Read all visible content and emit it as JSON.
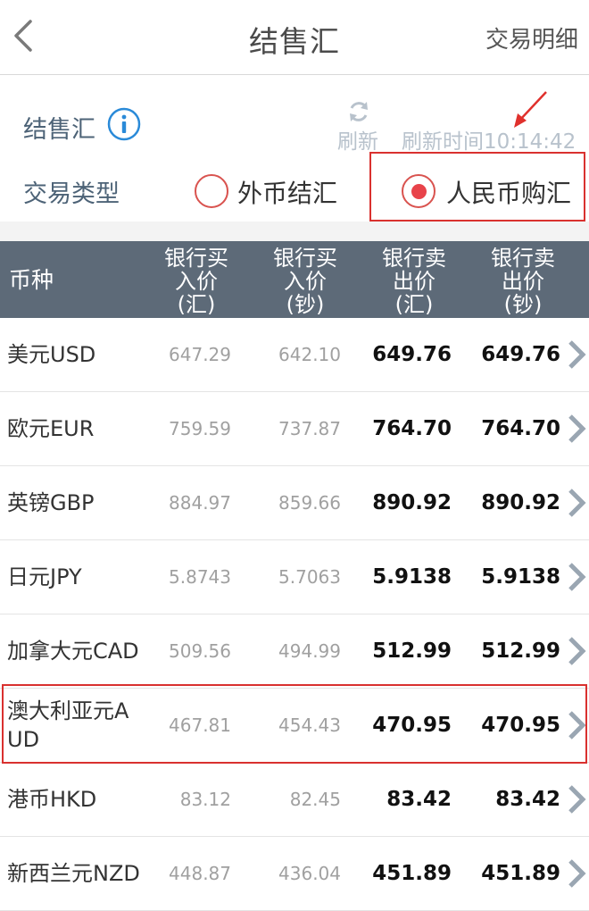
{
  "header": {
    "title": "结售汇",
    "detail_link": "交易明细"
  },
  "controls": {
    "label": "结售汇",
    "refresh_label": "刷新",
    "refresh_time": "刷新时间10:14:42",
    "type_label": "交易类型",
    "options": [
      {
        "label": "外币结汇",
        "selected": false
      },
      {
        "label": "人民币购汇",
        "selected": true
      }
    ]
  },
  "table": {
    "headers": [
      "币种",
      [
        "银行买",
        "入价",
        "(汇)"
      ],
      [
        "银行买",
        "入价",
        "(钞)"
      ],
      [
        "银行卖",
        "出价",
        "(汇)"
      ],
      [
        "银行卖",
        "出价",
        "(钞)"
      ]
    ],
    "rows": [
      {
        "currency": "美元USD",
        "buy_tt": "647.29",
        "buy_cash": "642.10",
        "sell_tt": "649.76",
        "sell_cash": "649.76"
      },
      {
        "currency": "欧元EUR",
        "buy_tt": "759.59",
        "buy_cash": "737.87",
        "sell_tt": "764.70",
        "sell_cash": "764.70"
      },
      {
        "currency": "英镑GBP",
        "buy_tt": "884.97",
        "buy_cash": "859.66",
        "sell_tt": "890.92",
        "sell_cash": "890.92"
      },
      {
        "currency": "日元JPY",
        "buy_tt": "5.8743",
        "buy_cash": "5.7063",
        "sell_tt": "5.9138",
        "sell_cash": "5.9138"
      },
      {
        "currency": "加拿大元CAD",
        "buy_tt": "509.56",
        "buy_cash": "494.99",
        "sell_tt": "512.99",
        "sell_cash": "512.99"
      },
      {
        "currency": "澳大利亚元AUD",
        "buy_tt": "467.81",
        "buy_cash": "454.43",
        "sell_tt": "470.95",
        "sell_cash": "470.95"
      },
      {
        "currency": "港币HKD",
        "buy_tt": "83.12",
        "buy_cash": "82.45",
        "sell_tt": "83.42",
        "sell_cash": "83.42"
      },
      {
        "currency": "新西兰元NZD",
        "buy_tt": "448.87",
        "buy_cash": "436.04",
        "sell_tt": "451.89",
        "sell_cash": "451.89"
      }
    ]
  },
  "colors": {
    "header_bg": "#5d6a78",
    "accent_red": "#e8434a",
    "highlight": "#d9312f",
    "info_blue": "#2a8ad8"
  }
}
